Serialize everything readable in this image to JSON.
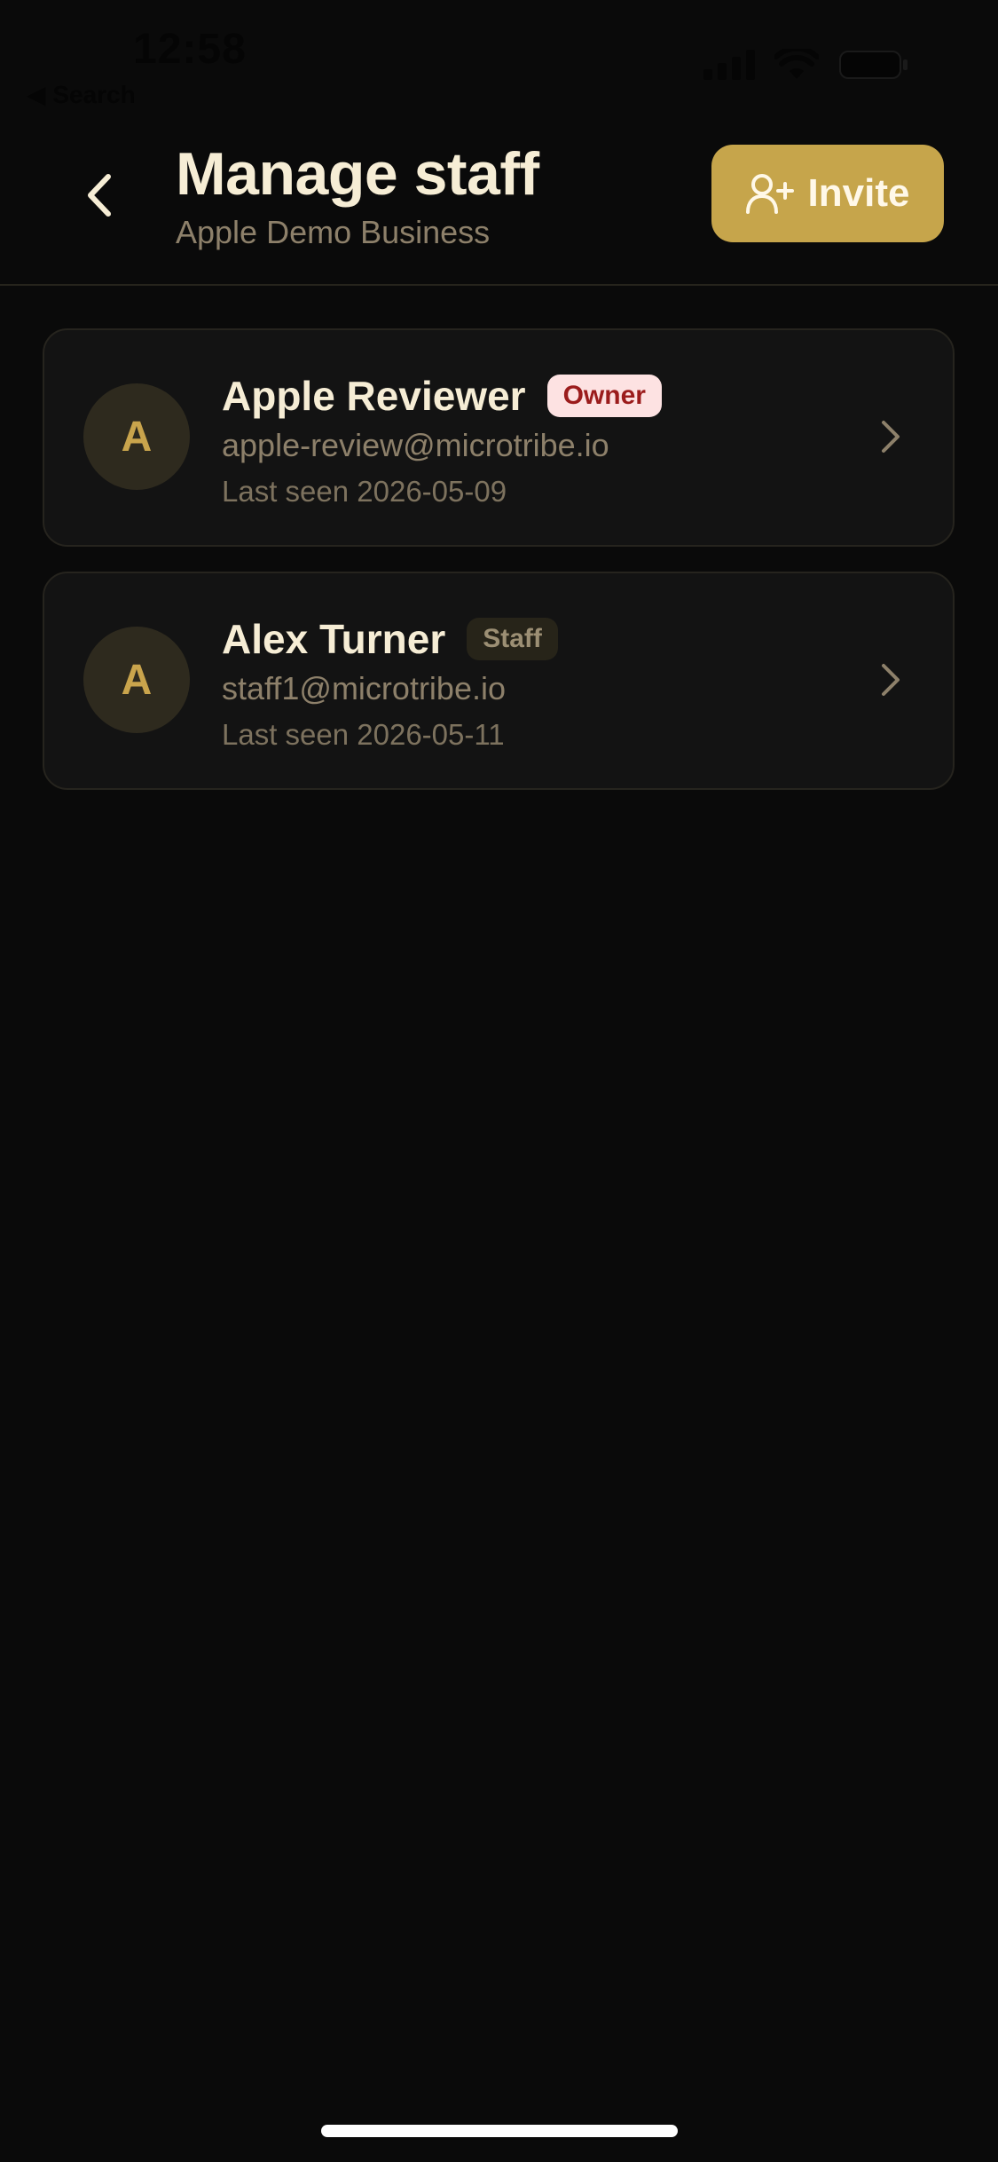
{
  "status_bar": {
    "time": "12:58",
    "back_app_label": "◀ Search"
  },
  "header": {
    "title": "Manage staff",
    "subtitle": "Apple Demo Business",
    "back_icon": "chevron-left-icon",
    "invite_label": "Invite",
    "invite_icon": "user-plus-icon"
  },
  "staff": [
    {
      "initial": "A",
      "name": "Apple Reviewer",
      "role": "Owner",
      "email": "apple-review@microtribe.io",
      "last_seen": "Last seen 2026-05-09"
    },
    {
      "initial": "A",
      "name": "Alex Turner",
      "role": "Staff",
      "email": "staff1@microtribe.io",
      "last_seen": "Last seen 2026-05-11"
    }
  ],
  "colors": {
    "background": "#0a0a0a",
    "accent": "#c6a54b",
    "title_text": "#f6edd5",
    "muted_text": "#8d806a",
    "owner_badge_bg": "#fde2e2",
    "owner_badge_text": "#9b1c1c"
  }
}
